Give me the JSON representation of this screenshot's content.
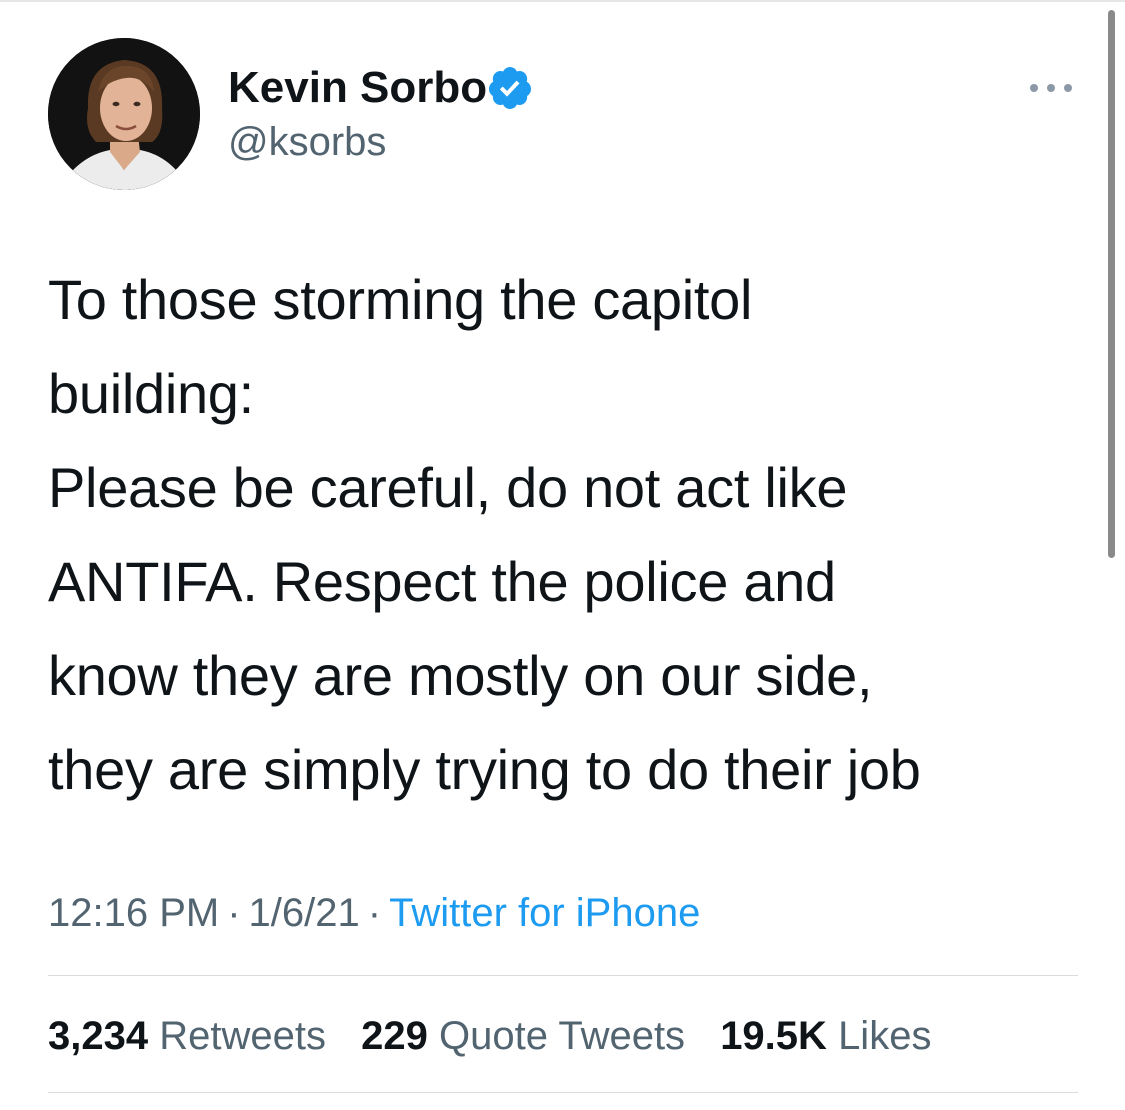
{
  "author": {
    "display_name": "Kevin Sorbo",
    "handle": "@ksorbs",
    "verified_icon": "verified-badge-icon",
    "more_icon": "more-options-icon"
  },
  "tweet": {
    "text": "To those storming the capitol\nbuilding:\nPlease be careful, do not act like\nANTIFA. Respect the police and\nknow they are mostly on our side,\nthey are simply trying to do their job",
    "time": "12:16 PM",
    "date": "1/6/21",
    "separator": "·",
    "source": "Twitter for iPhone"
  },
  "stats": {
    "retweets_count": "3,234",
    "retweets_label": "Retweets",
    "quotes_count": "229",
    "quotes_label": "Quote Tweets",
    "likes_count": "19.5K",
    "likes_label": "Likes"
  },
  "colors": {
    "text": "#0f1419",
    "secondary": "#536471",
    "link": "#1d9bf0",
    "divider": "#dcdcdc"
  }
}
